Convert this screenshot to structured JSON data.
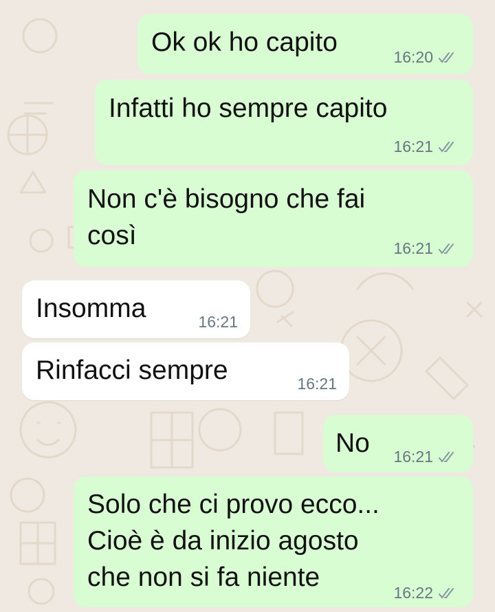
{
  "messages": [
    {
      "direction": "out",
      "text": "Ok ok ho capito",
      "time": "16:20",
      "status": "read-ticks-icon"
    },
    {
      "direction": "out",
      "text": "Infatti ho sempre capito",
      "time": "16:21",
      "status": "read-ticks-icon"
    },
    {
      "direction": "out",
      "text": "Non c'è bisogno che fai\ncosì",
      "time": "16:21",
      "status": "read-ticks-icon"
    },
    {
      "direction": "in",
      "text": "Insomma",
      "time": "16:21"
    },
    {
      "direction": "in",
      "text": "Rinfacci sempre",
      "time": "16:21"
    },
    {
      "direction": "out",
      "text": "No",
      "time": "16:21",
      "status": "read-ticks-icon"
    },
    {
      "direction": "out",
      "text": "Solo che ci provo ecco...\nCioè è da inizio agosto\nche non si fa niente",
      "time": "16:22",
      "status": "read-ticks-icon"
    }
  ],
  "colors": {
    "outgoing_bubble": "#d9fdd3",
    "incoming_bubble": "#ffffff",
    "wallpaper": "#efe9e1",
    "meta_text": "#667781"
  }
}
